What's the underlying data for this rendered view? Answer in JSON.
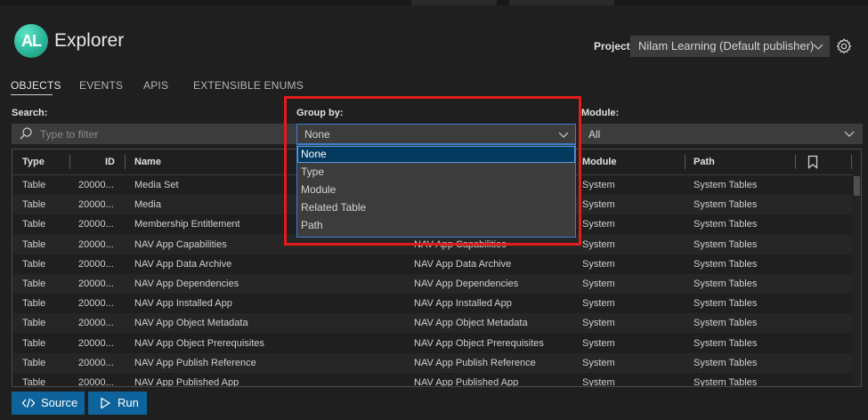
{
  "app": {
    "logo_text": "AL",
    "title": "Explorer"
  },
  "project": {
    "label": "Project:",
    "value": "Nilam Learning (Default publisher)"
  },
  "tabs": [
    {
      "label": "OBJECTS",
      "active": true
    },
    {
      "label": "EVENTS"
    },
    {
      "label": "APIS"
    },
    {
      "label": "EXTENSIBLE ENUMS"
    }
  ],
  "filters": {
    "search_label": "Search:",
    "search_placeholder": "Type to filter",
    "group_label": "Group by:",
    "group_value": "None",
    "module_label": "Module:",
    "module_value": "All"
  },
  "group_options": [
    "None",
    "Type",
    "Module",
    "Related Table",
    "Path"
  ],
  "columns": {
    "type": "Type",
    "id": "ID",
    "name": "Name",
    "module": "Module",
    "path": "Path"
  },
  "rows": [
    {
      "type": "Table",
      "id": "20000...",
      "name": "Media Set",
      "caption": "",
      "module": "System",
      "path": "System Tables"
    },
    {
      "type": "Table",
      "id": "20000...",
      "name": "Media",
      "caption": "",
      "module": "System",
      "path": "System Tables"
    },
    {
      "type": "Table",
      "id": "20000...",
      "name": "Membership Entitlement",
      "caption": "",
      "module": "System",
      "path": "System Tables"
    },
    {
      "type": "Table",
      "id": "20000...",
      "name": "NAV App Capabilities",
      "caption": "NAV App Capabilities",
      "module": "System",
      "path": "System Tables"
    },
    {
      "type": "Table",
      "id": "20000...",
      "name": "NAV App Data Archive",
      "caption": "NAV App Data Archive",
      "module": "System",
      "path": "System Tables"
    },
    {
      "type": "Table",
      "id": "20000...",
      "name": "NAV App Dependencies",
      "caption": "NAV App Dependencies",
      "module": "System",
      "path": "System Tables"
    },
    {
      "type": "Table",
      "id": "20000...",
      "name": "NAV App Installed App",
      "caption": "NAV App Installed App",
      "module": "System",
      "path": "System Tables"
    },
    {
      "type": "Table",
      "id": "20000...",
      "name": "NAV App Object Metadata",
      "caption": "NAV App Object Metadata",
      "module": "System",
      "path": "System Tables"
    },
    {
      "type": "Table",
      "id": "20000...",
      "name": "NAV App Object Prerequisites",
      "caption": "NAV App Object Prerequisites",
      "module": "System",
      "path": "System Tables"
    },
    {
      "type": "Table",
      "id": "20000...",
      "name": "NAV App Publish Reference",
      "caption": "NAV App Publish Reference",
      "module": "System",
      "path": "System Tables"
    },
    {
      "type": "Table",
      "id": "20000...",
      "name": "NAV App Published App",
      "caption": "NAV App Published App",
      "module": "System",
      "path": "System Tables"
    }
  ],
  "buttons": {
    "source": "Source",
    "run": "Run"
  },
  "icons": [
    "chevron-down-icon",
    "gear-icon",
    "search-icon",
    "bookmark-icon",
    "code-icon",
    "play-icon"
  ],
  "colors": {
    "accent_button": "#0e639c",
    "focus_border": "#3b7ed1",
    "highlight_box": "#e31b1b",
    "selected_option": "#04395e"
  }
}
